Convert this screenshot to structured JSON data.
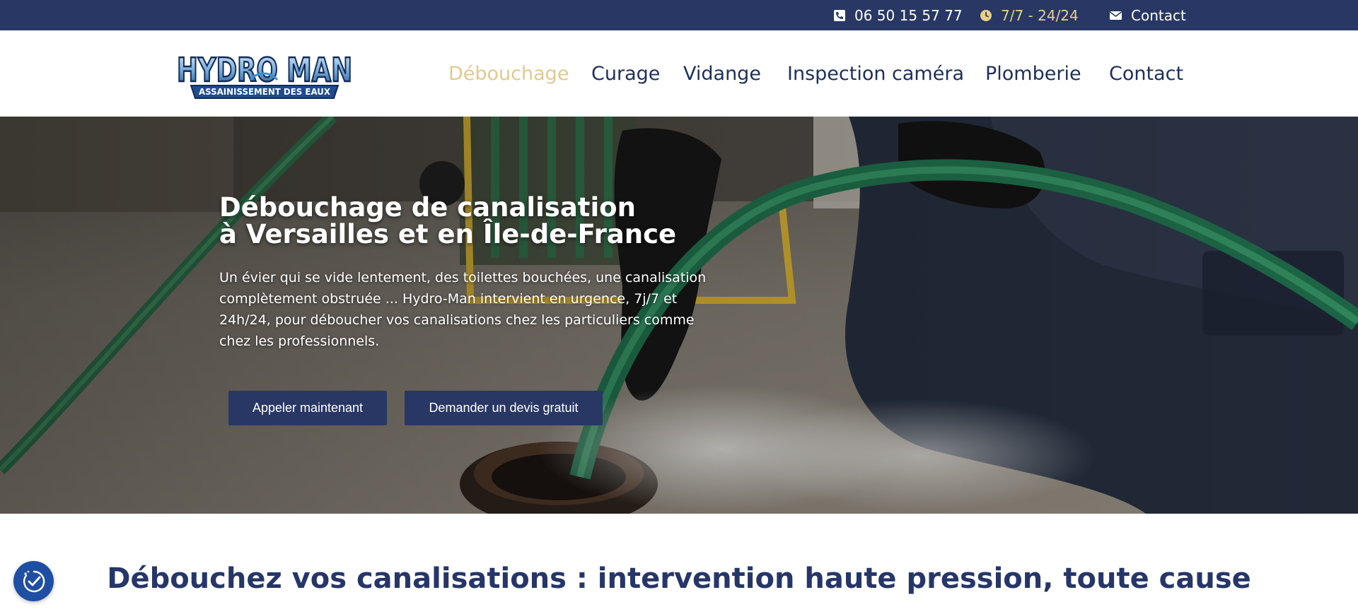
{
  "topbar": {
    "phone": "06 50 15 57 77",
    "hours": "7/7 - 24/24",
    "contact": "Contact",
    "icons": [
      "phone-icon",
      "clock-icon",
      "envelope-icon"
    ]
  },
  "logo": {
    "line1": "HYDRO MAN",
    "line2": "ASSAINISSEMENT DES EAUX"
  },
  "nav": {
    "items": [
      {
        "label": "Débouchage",
        "active": true
      },
      {
        "label": "Curage"
      },
      {
        "label": "Vidange"
      },
      {
        "label": "Inspection caméra"
      },
      {
        "label": "Plomberie"
      },
      {
        "label": "Contact"
      }
    ]
  },
  "hero": {
    "title_line1": "Débouchage de canalisation",
    "title_line2": "à Versailles et en Île-de-France",
    "text": "Un évier qui se vide lentement, des toilettes bouchées, une canalisation complètement obstruée ... Hydro-Man intervient en urgence, 7j/7 et 24h/24, pour déboucher vos canalisations chez les particuliers comme chez les professionnels.",
    "btn_call": "Appeler maintenant",
    "btn_quote": "Demander un devis gratuit"
  },
  "section": {
    "title": "Débouchez vos canalisations : intervention haute pression, toute cause"
  },
  "colors": {
    "navy": "#283764",
    "gold": "#e2c98e",
    "text_dark": "#1f2f5c"
  }
}
